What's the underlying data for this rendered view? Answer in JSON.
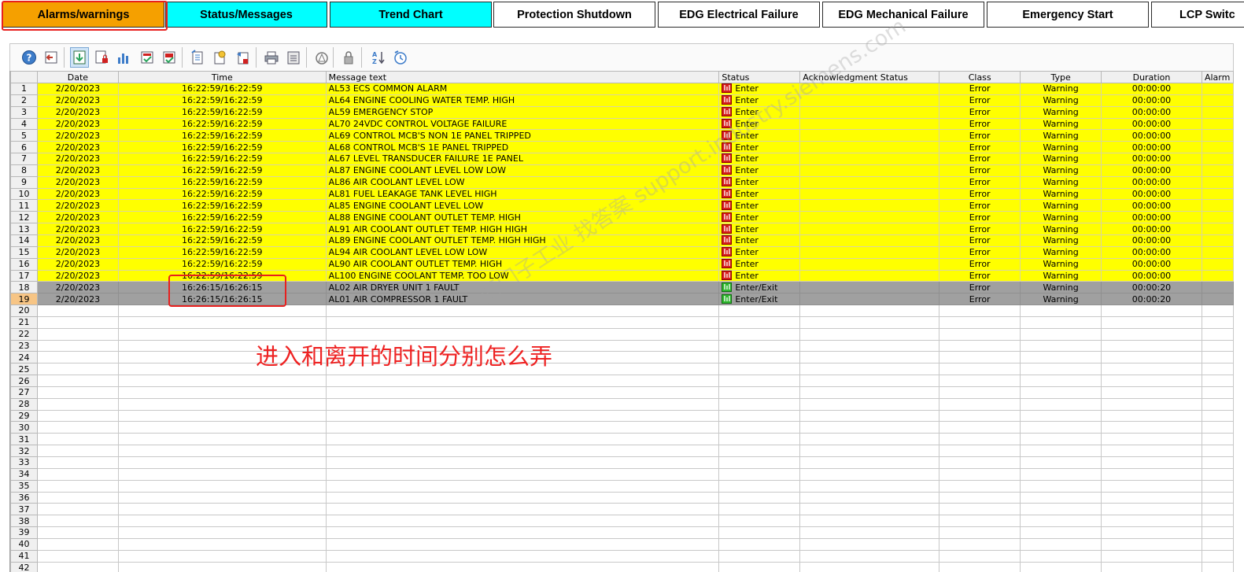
{
  "tabs": [
    {
      "label": "Alarms/warnings",
      "style": "orange"
    },
    {
      "label": "Status/Messages",
      "style": "cyan"
    },
    {
      "label": "Trend Chart",
      "style": "cyan"
    },
    {
      "label": "Protection Shutdown",
      "style": "white"
    },
    {
      "label": "EDG Electrical Failure",
      "style": "white"
    },
    {
      "label": "EDG Mechanical Failure",
      "style": "white"
    },
    {
      "label": "Emergency Start",
      "style": "white"
    },
    {
      "label": "LCP Switc",
      "style": "white"
    }
  ],
  "toolbar": {
    "buttons": [
      "help-icon",
      "exit-icon",
      "current-messages-icon",
      "locked-messages-icon",
      "statistics-icon",
      "acknowledge-icon",
      "group-acknowledge-icon",
      "message-list-icon",
      "history-icon",
      "hidden-messages-icon",
      "print-icon",
      "report-icon",
      "loop-in-alarm-icon",
      "lock-icon",
      "sort-icon",
      "time-base-icon"
    ]
  },
  "grid": {
    "columns": [
      "",
      "Date",
      "Time",
      "Message text",
      "Status",
      "Acknowledgment Status",
      "Class",
      "Type",
      "Duration",
      "Alarm"
    ],
    "rows": [
      {
        "n": "1",
        "date": "2/20/2023",
        "time": "16:22:59/16:22:59",
        "text": "AL53 ECS COMMON ALARM",
        "status": "Enter",
        "ack": "",
        "cls": "Error",
        "type": "Warning",
        "duration": "00:00:00",
        "kind": "yellow"
      },
      {
        "n": "2",
        "date": "2/20/2023",
        "time": "16:22:59/16:22:59",
        "text": "AL64 ENGINE COOLING WATER TEMP. HIGH",
        "status": "Enter",
        "ack": "",
        "cls": "Error",
        "type": "Warning",
        "duration": "00:00:00",
        "kind": "yellow"
      },
      {
        "n": "3",
        "date": "2/20/2023",
        "time": "16:22:59/16:22:59",
        "text": "AL59 EMERGENCY STOP",
        "status": "Enter",
        "ack": "",
        "cls": "Error",
        "type": "Warning",
        "duration": "00:00:00",
        "kind": "yellow"
      },
      {
        "n": "4",
        "date": "2/20/2023",
        "time": "16:22:59/16:22:59",
        "text": "AL70 24VDC CONTROL VOLTAGE FAILURE",
        "status": "Enter",
        "ack": "",
        "cls": "Error",
        "type": "Warning",
        "duration": "00:00:00",
        "kind": "yellow"
      },
      {
        "n": "5",
        "date": "2/20/2023",
        "time": "16:22:59/16:22:59",
        "text": "AL69 CONTROL MCB'S NON 1E PANEL TRIPPED",
        "status": "Enter",
        "ack": "",
        "cls": "Error",
        "type": "Warning",
        "duration": "00:00:00",
        "kind": "yellow"
      },
      {
        "n": "6",
        "date": "2/20/2023",
        "time": "16:22:59/16:22:59",
        "text": "AL68 CONTROL MCB'S 1E PANEL TRIPPED",
        "status": "Enter",
        "ack": "",
        "cls": "Error",
        "type": "Warning",
        "duration": "00:00:00",
        "kind": "yellow"
      },
      {
        "n": "7",
        "date": "2/20/2023",
        "time": "16:22:59/16:22:59",
        "text": "AL67 LEVEL TRANSDUCER FAILURE 1E PANEL",
        "status": "Enter",
        "ack": "",
        "cls": "Error",
        "type": "Warning",
        "duration": "00:00:00",
        "kind": "yellow"
      },
      {
        "n": "8",
        "date": "2/20/2023",
        "time": "16:22:59/16:22:59",
        "text": "AL87 ENGINE COOLANT LEVEL LOW LOW",
        "status": "Enter",
        "ack": "",
        "cls": "Error",
        "type": "Warning",
        "duration": "00:00:00",
        "kind": "yellow"
      },
      {
        "n": "9",
        "date": "2/20/2023",
        "time": "16:22:59/16:22:59",
        "text": "AL86 AIR COOLANT LEVEL LOW",
        "status": "Enter",
        "ack": "",
        "cls": "Error",
        "type": "Warning",
        "duration": "00:00:00",
        "kind": "yellow"
      },
      {
        "n": "10",
        "date": "2/20/2023",
        "time": "16:22:59/16:22:59",
        "text": "AL81 FUEL LEAKAGE TANK LEVEL HIGH",
        "status": "Enter",
        "ack": "",
        "cls": "Error",
        "type": "Warning",
        "duration": "00:00:00",
        "kind": "yellow"
      },
      {
        "n": "11",
        "date": "2/20/2023",
        "time": "16:22:59/16:22:59",
        "text": "AL85 ENGINE COOLANT LEVEL LOW",
        "status": "Enter",
        "ack": "",
        "cls": "Error",
        "type": "Warning",
        "duration": "00:00:00",
        "kind": "yellow"
      },
      {
        "n": "12",
        "date": "2/20/2023",
        "time": "16:22:59/16:22:59",
        "text": "AL88 ENGINE COOLANT OUTLET TEMP. HIGH",
        "status": "Enter",
        "ack": "",
        "cls": "Error",
        "type": "Warning",
        "duration": "00:00:00",
        "kind": "yellow"
      },
      {
        "n": "13",
        "date": "2/20/2023",
        "time": "16:22:59/16:22:59",
        "text": "AL91 AIR COOLANT OUTLET TEMP. HIGH HIGH",
        "status": "Enter",
        "ack": "",
        "cls": "Error",
        "type": "Warning",
        "duration": "00:00:00",
        "kind": "yellow"
      },
      {
        "n": "14",
        "date": "2/20/2023",
        "time": "16:22:59/16:22:59",
        "text": "AL89 ENGINE COOLANT OUTLET TEMP. HIGH HIGH",
        "status": "Enter",
        "ack": "",
        "cls": "Error",
        "type": "Warning",
        "duration": "00:00:00",
        "kind": "yellow"
      },
      {
        "n": "15",
        "date": "2/20/2023",
        "time": "16:22:59/16:22:59",
        "text": "AL94 AIR COOLANT LEVEL LOW LOW",
        "status": "Enter",
        "ack": "",
        "cls": "Error",
        "type": "Warning",
        "duration": "00:00:00",
        "kind": "yellow"
      },
      {
        "n": "16",
        "date": "2/20/2023",
        "time": "16:22:59/16:22:59",
        "text": "AL90 AIR COOLANT OUTLET TEMP. HIGH",
        "status": "Enter",
        "ack": "",
        "cls": "Error",
        "type": "Warning",
        "duration": "00:00:00",
        "kind": "yellow"
      },
      {
        "n": "17",
        "date": "2/20/2023",
        "time": "16:22:59/16:22:59",
        "text": "AL100 ENGINE COOLANT TEMP. TOO LOW",
        "status": "Enter",
        "ack": "",
        "cls": "Error",
        "type": "Warning",
        "duration": "00:00:00",
        "kind": "yellow"
      },
      {
        "n": "18",
        "date": "2/20/2023",
        "time": "16:26:15/16:26:15",
        "text": "AL02 AIR DRYER UNIT 1 FAULT",
        "status": "Enter/Exit",
        "ack": "",
        "cls": "Error",
        "type": "Warning",
        "duration": "00:00:20",
        "kind": "gray"
      },
      {
        "n": "19",
        "date": "2/20/2023",
        "time": "16:26:15/16:26:15",
        "text": "AL01 AIR COMPRESSOR 1 FAULT",
        "status": "Enter/Exit",
        "ack": "",
        "cls": "Error",
        "type": "Warning",
        "duration": "00:00:20",
        "kind": "gray",
        "selected": true
      }
    ],
    "empty_row_numbers": [
      "20",
      "21",
      "22",
      "23",
      "24",
      "25",
      "26",
      "27",
      "28",
      "29",
      "30",
      "31",
      "32",
      "33",
      "34",
      "35",
      "36",
      "37",
      "38",
      "39",
      "40",
      "41",
      "42"
    ]
  },
  "annotation": {
    "text": "进入和离开的时间分别怎么弄",
    "color": "#ee2222"
  },
  "watermark": {
    "text": "西门子工业 找答案 support.industry.siemens.com"
  },
  "colors": {
    "alarm_row": "#ffff00",
    "exited_row": "#a0a0a0",
    "tab_active": "#f5a000",
    "tab_cyan": "#00ffff",
    "highlight": "#e8201e"
  }
}
